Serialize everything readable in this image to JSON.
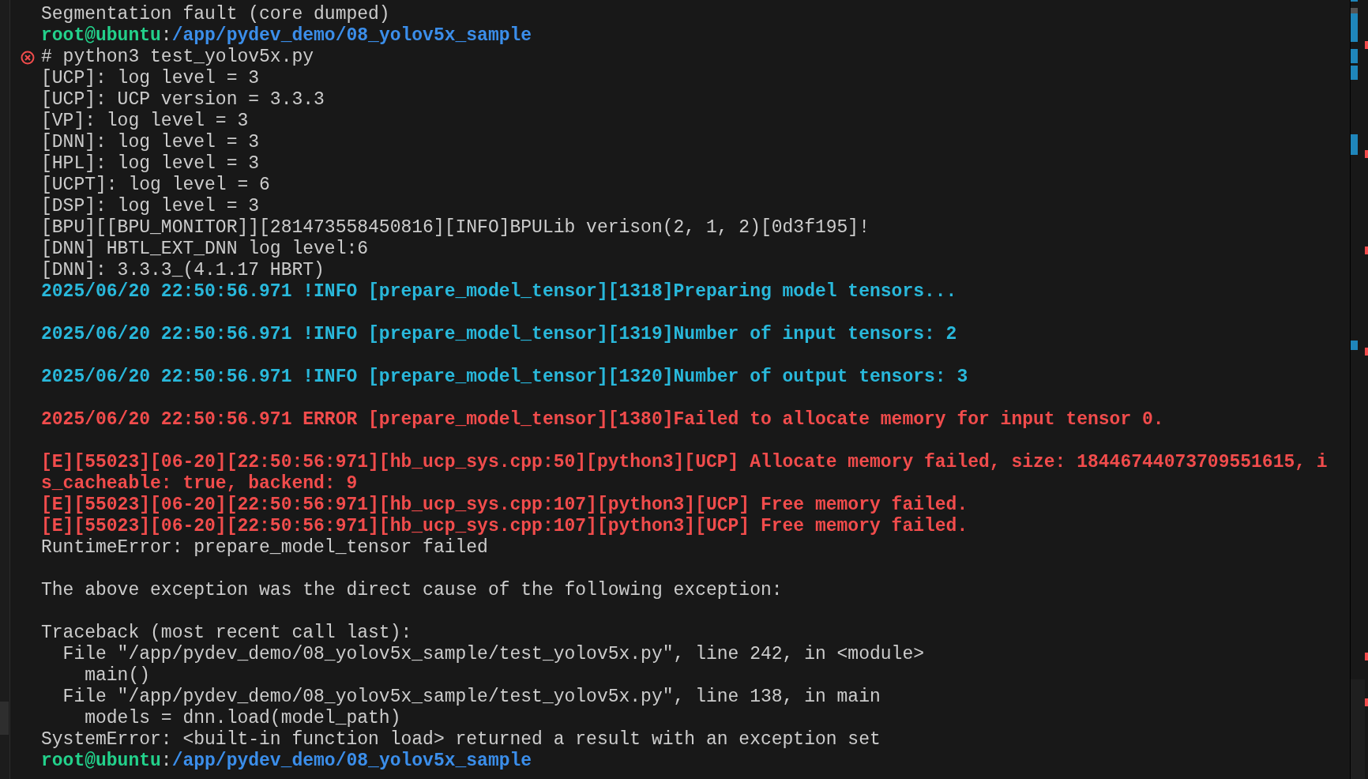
{
  "terminal": {
    "lines": [
      {
        "kind": "output",
        "text": "Segmentation fault (core dumped)"
      },
      {
        "kind": "prompt",
        "user": "root@ubuntu",
        "separator": ":",
        "path": "/app/pydev_demo/08_yolov5x_sample"
      },
      {
        "kind": "command",
        "text": "# python3 test_yolov5x.py",
        "failed": true
      },
      {
        "kind": "output",
        "text": "[UCP]: log level = 3"
      },
      {
        "kind": "output",
        "text": "[UCP]: UCP version = 3.3.3"
      },
      {
        "kind": "output",
        "text": "[VP]: log level = 3"
      },
      {
        "kind": "output",
        "text": "[DNN]: log level = 3"
      },
      {
        "kind": "output",
        "text": "[HPL]: log level = 3"
      },
      {
        "kind": "output",
        "text": "[UCPT]: log level = 6"
      },
      {
        "kind": "output",
        "text": "[DSP]: log level = 3"
      },
      {
        "kind": "output",
        "text": "[BPU][[BPU_MONITOR]][281473558450816][INFO]BPULib verison(2, 1, 2)[0d3f195]!"
      },
      {
        "kind": "output",
        "text": "[DNN] HBTL_EXT_DNN log level:6"
      },
      {
        "kind": "output",
        "text": "[DNN]: 3.3.3_(4.1.17 HBRT)"
      },
      {
        "kind": "info",
        "text": "2025/06/20 22:50:56.971 !INFO [prepare_model_tensor][1318]Preparing model tensors..."
      },
      {
        "kind": "blank"
      },
      {
        "kind": "info",
        "text": "2025/06/20 22:50:56.971 !INFO [prepare_model_tensor][1319]Number of input tensors: 2"
      },
      {
        "kind": "blank"
      },
      {
        "kind": "info",
        "text": "2025/06/20 22:50:56.971 !INFO [prepare_model_tensor][1320]Number of output tensors: 3"
      },
      {
        "kind": "blank"
      },
      {
        "kind": "error",
        "text": "2025/06/20 22:50:56.971 ERROR [prepare_model_tensor][1380]Failed to allocate memory for input tensor 0."
      },
      {
        "kind": "blank"
      },
      {
        "kind": "error",
        "text": "[E][55023][06-20][22:50:56:971][hb_ucp_sys.cpp:50][python3][UCP] Allocate memory failed, size: 18446744073709551615, i"
      },
      {
        "kind": "error",
        "text": "s_cacheable: true, backend: 9"
      },
      {
        "kind": "error",
        "text": "[E][55023][06-20][22:50:56:971][hb_ucp_sys.cpp:107][python3][UCP] Free memory failed."
      },
      {
        "kind": "error",
        "text": "[E][55023][06-20][22:50:56:971][hb_ucp_sys.cpp:107][python3][UCP] Free memory failed."
      },
      {
        "kind": "output",
        "text": "RuntimeError: prepare_model_tensor failed"
      },
      {
        "kind": "blank"
      },
      {
        "kind": "output",
        "text": "The above exception was the direct cause of the following exception:"
      },
      {
        "kind": "blank"
      },
      {
        "kind": "output",
        "text": "Traceback (most recent call last):"
      },
      {
        "kind": "output",
        "text": "  File \"/app/pydev_demo/08_yolov5x_sample/test_yolov5x.py\", line 242, in <module>"
      },
      {
        "kind": "output",
        "text": "    main()"
      },
      {
        "kind": "output",
        "text": "  File \"/app/pydev_demo/08_yolov5x_sample/test_yolov5x.py\", line 138, in main"
      },
      {
        "kind": "output",
        "text": "    models = dnn.load(model_path)"
      },
      {
        "kind": "output",
        "text": "SystemError: <built-in function load> returned a result with an exception set"
      },
      {
        "kind": "prompt",
        "user": "root@ubuntu",
        "separator": ":",
        "path": "/app/pydev_demo/08_yolov5x_sample"
      }
    ]
  }
}
